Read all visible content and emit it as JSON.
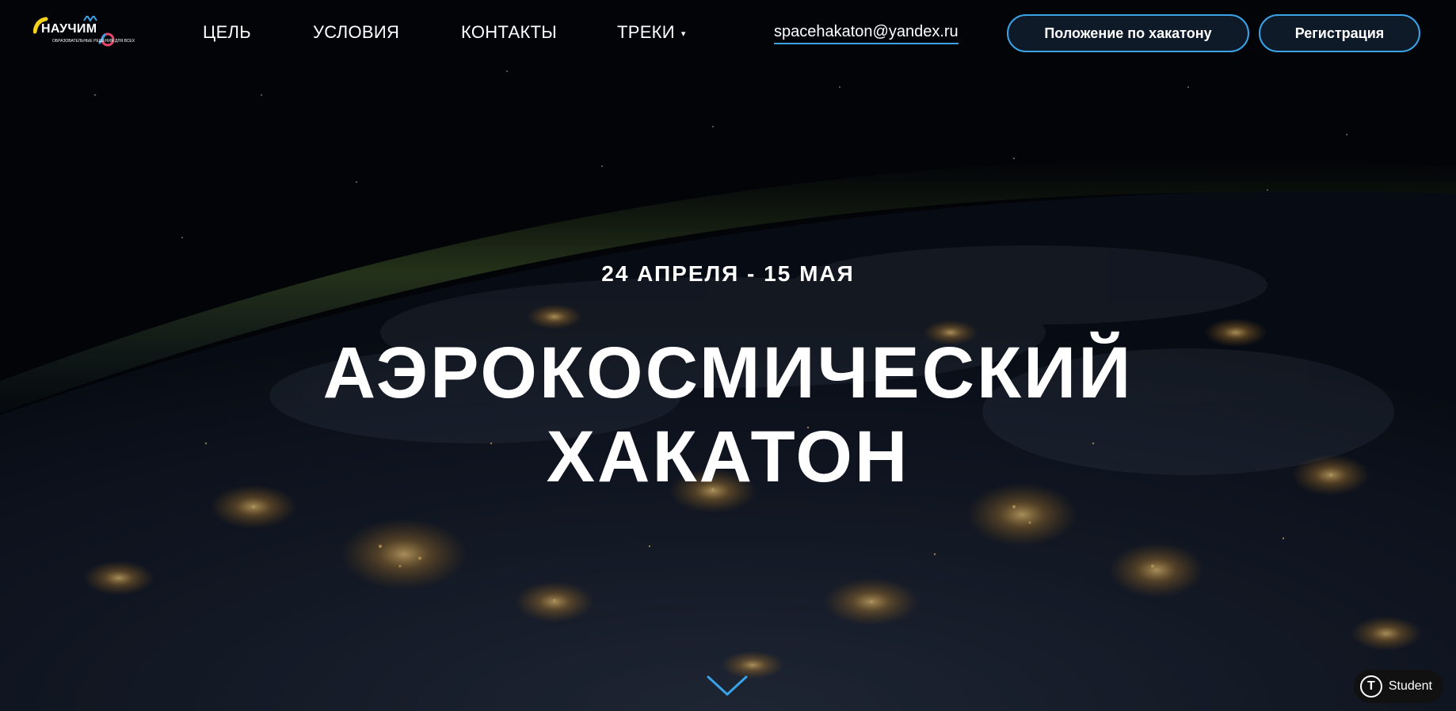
{
  "header": {
    "logo": {
      "text": "НАУЧИМ",
      "subtext": "ОБРАЗОВАТЕЛЬНЫЕ РЕШЕНИЯ ДЛЯ ВСЕХ"
    },
    "nav": [
      {
        "label": "ЦЕЛЬ"
      },
      {
        "label": "УСЛОВИЯ"
      },
      {
        "label": "КОНТАКТЫ"
      },
      {
        "label": "ТРЕКИ",
        "caret": "▾"
      }
    ],
    "email": "spacehakaton@yandex.ru",
    "buttons": {
      "regulations": "Положение по хакатону",
      "register": "Регистрация"
    }
  },
  "hero": {
    "dates": "24 АПРЕЛЯ - 15 МАЯ",
    "title_line1": "АЭРОКОСМИЧЕСКИЙ",
    "title_line2": "ХАКАТОН"
  },
  "badge": {
    "icon_letter": "T",
    "label": "Student"
  },
  "colors": {
    "accent": "#3aa3e8",
    "button_bg": "#0f1a29",
    "text": "#ffffff",
    "background": "#05070c"
  },
  "icons": {
    "scroll": "chevron-down-icon",
    "badge": "tilda-icon"
  }
}
